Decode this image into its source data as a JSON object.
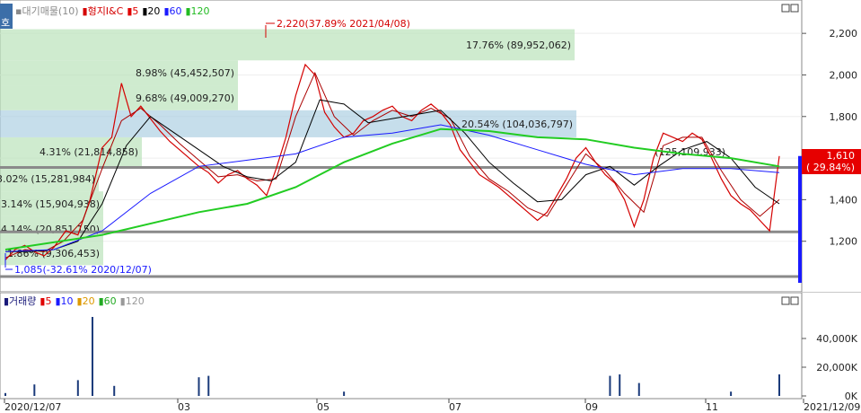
{
  "price_panel": {
    "tab_label": "호",
    "legend": [
      {
        "text": "▪대기매물(10)",
        "color": "#8a8a8a"
      },
      {
        "text": "▮형지I&C",
        "color": "#d40000"
      },
      {
        "text": "▮5",
        "color": "#e00000"
      },
      {
        "text": "▮20",
        "color": "#000000"
      },
      {
        "text": "▮60",
        "color": "#1a1aff"
      },
      {
        "text": "▮120",
        "color": "#22bb22"
      }
    ],
    "max_annotation": "2,220(37.89% 2021/04/08)",
    "min_annotation": "1,085(-32.61% 2020/12/07)",
    "current_price": "1,610",
    "current_change": "( 29.84%)",
    "y_axis": {
      "min": 1000,
      "max": 2300,
      "ticks": [
        "1,200",
        "1,400",
        "1,600",
        "1,800",
        "2,000",
        "2,200"
      ]
    }
  },
  "volume_panel": {
    "legend": [
      {
        "text": "▮거래량",
        "color": "#1a1a7a"
      },
      {
        "text": "▮5",
        "color": "#e00000"
      },
      {
        "text": "▮10",
        "color": "#1a1aff"
      },
      {
        "text": "▮20",
        "color": "#dd9900"
      },
      {
        "text": "▮60",
        "color": "#22aa22"
      },
      {
        "text": "▮120",
        "color": "#999999"
      }
    ],
    "y_axis": {
      "min": 0,
      "max": 60000,
      "ticks": [
        "0K",
        "20,000K",
        "40,000K"
      ]
    }
  },
  "x_axis_labels": [
    "2020/12/07",
    "03",
    "05",
    "07",
    "09",
    "11",
    "2021/12/09"
  ],
  "chart_data": {
    "type": "line",
    "title": "형지I&C",
    "volume_profile": [
      {
        "price_low": 1085,
        "price_high": 1200,
        "label": "1.86% (9,306,453)"
      },
      {
        "price_low": 1200,
        "price_high": 1320,
        "label": "4.14% (20,851,150)"
      },
      {
        "price_low": 1320,
        "price_high": 1440,
        "label": "3.14% (15,904,938)"
      },
      {
        "price_low": 1440,
        "price_high": 1560,
        "label": "3.02% (15,281,984)"
      },
      {
        "price_low": 1560,
        "price_high": 1700,
        "label": "4.31% (21,814,858)"
      },
      {
        "price_low": 1700,
        "price_high": 1830,
        "label": "20.54% (104,036,797)"
      },
      {
        "price_low": 1830,
        "price_high": 1950,
        "label": "9.68% (49,009,270)"
      },
      {
        "price_low": 1950,
        "price_high": 2070,
        "label": "8.98% (45,452,507)"
      },
      {
        "price_low": 2070,
        "price_high": 2220,
        "label": "17.76% (89,952,062)"
      },
      {
        "price_low": 1560,
        "price_high": 1700,
        "label": "(125,109,933)"
      }
    ],
    "horizontal_lines": [
      1555,
      1245,
      1030
    ],
    "series": [
      {
        "name": "형지I&C",
        "values": [
          [
            0,
            1110
          ],
          [
            4,
            1160
          ],
          [
            8,
            1180
          ],
          [
            12,
            1150
          ],
          [
            16,
            1130
          ],
          [
            20,
            1170
          ],
          [
            25,
            1250
          ],
          [
            30,
            1230
          ],
          [
            35,
            1400
          ],
          [
            40,
            1650
          ],
          [
            44,
            1700
          ],
          [
            48,
            1960
          ],
          [
            52,
            1800
          ],
          [
            56,
            1850
          ],
          [
            60,
            1790
          ],
          [
            64,
            1730
          ],
          [
            68,
            1680
          ],
          [
            72,
            1640
          ],
          [
            76,
            1600
          ],
          [
            80,
            1560
          ],
          [
            84,
            1530
          ],
          [
            88,
            1480
          ],
          [
            92,
            1520
          ],
          [
            96,
            1540
          ],
          [
            100,
            1500
          ],
          [
            104,
            1470
          ],
          [
            108,
            1420
          ],
          [
            112,
            1550
          ],
          [
            116,
            1700
          ],
          [
            120,
            1900
          ],
          [
            124,
            2050
          ],
          [
            128,
            2000
          ],
          [
            132,
            1820
          ],
          [
            136,
            1750
          ],
          [
            140,
            1700
          ],
          [
            144,
            1720
          ],
          [
            148,
            1780
          ],
          [
            152,
            1800
          ],
          [
            156,
            1830
          ],
          [
            160,
            1850
          ],
          [
            164,
            1800
          ],
          [
            168,
            1780
          ],
          [
            172,
            1830
          ],
          [
            176,
            1860
          ],
          [
            180,
            1820
          ],
          [
            184,
            1760
          ],
          [
            188,
            1640
          ],
          [
            192,
            1580
          ],
          [
            196,
            1520
          ],
          [
            200,
            1490
          ],
          [
            204,
            1460
          ],
          [
            208,
            1420
          ],
          [
            212,
            1380
          ],
          [
            216,
            1340
          ],
          [
            220,
            1300
          ],
          [
            224,
            1340
          ],
          [
            228,
            1420
          ],
          [
            232,
            1500
          ],
          [
            236,
            1600
          ],
          [
            240,
            1650
          ],
          [
            244,
            1580
          ],
          [
            248,
            1520
          ],
          [
            252,
            1480
          ],
          [
            256,
            1400
          ],
          [
            260,
            1270
          ],
          [
            264,
            1400
          ],
          [
            268,
            1600
          ],
          [
            272,
            1720
          ],
          [
            276,
            1700
          ],
          [
            280,
            1680
          ],
          [
            284,
            1720
          ],
          [
            288,
            1690
          ],
          [
            292,
            1600
          ],
          [
            296,
            1500
          ],
          [
            300,
            1420
          ],
          [
            304,
            1380
          ],
          [
            308,
            1350
          ],
          [
            312,
            1300
          ],
          [
            316,
            1250
          ],
          [
            320,
            1610
          ]
        ]
      },
      {
        "name": "5",
        "values": [
          [
            0,
            1120
          ],
          [
            8,
            1160
          ],
          [
            16,
            1150
          ],
          [
            24,
            1200
          ],
          [
            32,
            1300
          ],
          [
            40,
            1550
          ],
          [
            48,
            1780
          ],
          [
            56,
            1840
          ],
          [
            64,
            1760
          ],
          [
            72,
            1670
          ],
          [
            80,
            1590
          ],
          [
            88,
            1510
          ],
          [
            96,
            1520
          ],
          [
            104,
            1490
          ],
          [
            112,
            1500
          ],
          [
            120,
            1800
          ],
          [
            128,
            2010
          ],
          [
            136,
            1800
          ],
          [
            144,
            1710
          ],
          [
            152,
            1780
          ],
          [
            160,
            1830
          ],
          [
            168,
            1800
          ],
          [
            176,
            1840
          ],
          [
            184,
            1790
          ],
          [
            192,
            1610
          ],
          [
            200,
            1500
          ],
          [
            208,
            1440
          ],
          [
            216,
            1360
          ],
          [
            224,
            1320
          ],
          [
            232,
            1470
          ],
          [
            240,
            1620
          ],
          [
            248,
            1540
          ],
          [
            256,
            1430
          ],
          [
            264,
            1340
          ],
          [
            272,
            1660
          ],
          [
            280,
            1700
          ],
          [
            288,
            1700
          ],
          [
            296,
            1540
          ],
          [
            304,
            1400
          ],
          [
            312,
            1320
          ],
          [
            320,
            1400
          ]
        ]
      },
      {
        "name": "20",
        "values": [
          [
            0,
            1150
          ],
          [
            10,
            1150
          ],
          [
            20,
            1160
          ],
          [
            30,
            1200
          ],
          [
            40,
            1380
          ],
          [
            50,
            1660
          ],
          [
            60,
            1800
          ],
          [
            70,
            1720
          ],
          [
            80,
            1640
          ],
          [
            90,
            1560
          ],
          [
            100,
            1510
          ],
          [
            110,
            1490
          ],
          [
            120,
            1580
          ],
          [
            130,
            1880
          ],
          [
            140,
            1860
          ],
          [
            150,
            1770
          ],
          [
            160,
            1790
          ],
          [
            170,
            1810
          ],
          [
            180,
            1830
          ],
          [
            190,
            1720
          ],
          [
            200,
            1580
          ],
          [
            210,
            1480
          ],
          [
            220,
            1390
          ],
          [
            230,
            1400
          ],
          [
            240,
            1520
          ],
          [
            250,
            1560
          ],
          [
            260,
            1470
          ],
          [
            270,
            1560
          ],
          [
            280,
            1640
          ],
          [
            290,
            1680
          ],
          [
            300,
            1600
          ],
          [
            310,
            1460
          ],
          [
            320,
            1380
          ]
        ]
      },
      {
        "name": "60",
        "values": [
          [
            0,
            1150
          ],
          [
            20,
            1160
          ],
          [
            40,
            1250
          ],
          [
            60,
            1430
          ],
          [
            80,
            1560
          ],
          [
            100,
            1590
          ],
          [
            120,
            1620
          ],
          [
            140,
            1700
          ],
          [
            160,
            1720
          ],
          [
            180,
            1760
          ],
          [
            200,
            1710
          ],
          [
            220,
            1640
          ],
          [
            240,
            1570
          ],
          [
            260,
            1520
          ],
          [
            280,
            1550
          ],
          [
            300,
            1550
          ],
          [
            320,
            1530
          ]
        ]
      },
      {
        "name": "120",
        "values": [
          [
            0,
            1160
          ],
          [
            40,
            1230
          ],
          [
            80,
            1340
          ],
          [
            100,
            1380
          ],
          [
            120,
            1460
          ],
          [
            140,
            1580
          ],
          [
            160,
            1670
          ],
          [
            180,
            1740
          ],
          [
            200,
            1730
          ],
          [
            220,
            1700
          ],
          [
            240,
            1690
          ],
          [
            260,
            1650
          ],
          [
            280,
            1620
          ],
          [
            300,
            1600
          ],
          [
            320,
            1560
          ]
        ]
      }
    ],
    "volume": {
      "name": "거래량",
      "values": [
        [
          0,
          2000
        ],
        [
          12,
          8000
        ],
        [
          30,
          11000
        ],
        [
          36,
          55000
        ],
        [
          45,
          7000
        ],
        [
          80,
          13000
        ],
        [
          84,
          14000
        ],
        [
          140,
          3000
        ],
        [
          250,
          14000
        ],
        [
          254,
          15000
        ],
        [
          262,
          9000
        ],
        [
          300,
          3000
        ],
        [
          320,
          15000
        ]
      ]
    }
  }
}
